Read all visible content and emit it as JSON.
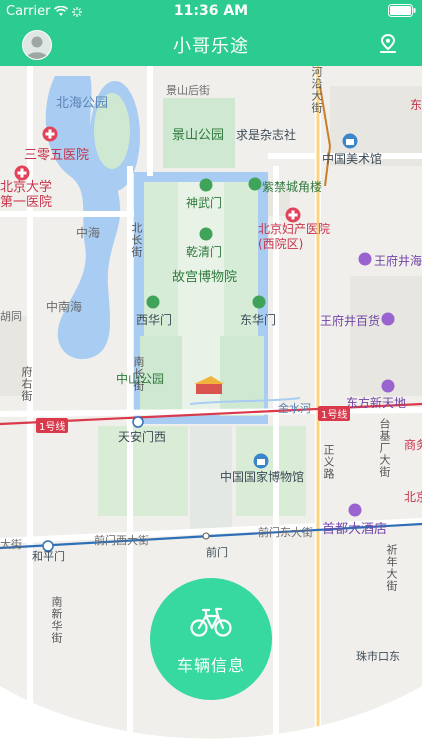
{
  "status_bar": {
    "carrier": "Carrier",
    "time": "11:36 AM"
  },
  "nav": {
    "title": "小哥乐途"
  },
  "map": {
    "labels": {
      "beihai_park": "北海公园",
      "jingshan_houjie": "景山后街",
      "jingshan_park": "景山公园",
      "qiushi_zazhishe": "求是杂志社",
      "china_art_museum": "中国美术馆",
      "hospital_305": "三零五医院",
      "pku_first_hospital": "北京大学\n第一医院",
      "jiaolou": "紫禁城角楼",
      "shenwumen": "神武门",
      "qianqingmen": "乾清门",
      "palace_museum": "故宫博物院",
      "maternity_hospital": "北京妇产医院\n(西院区)",
      "wangfujing_shop": "王府井海",
      "zhonghai": "中海",
      "beichangjie": "北长街",
      "nanchangjie": "南长街",
      "zhongnanhai": "中南海",
      "xihuamen": "西华门",
      "donghuamen": "东华门",
      "wangfujing_baihuo": "王府井百货",
      "hutong": "胡同",
      "zhongshan_park": "中山公园",
      "jinshuihe": "金水河",
      "dongfang_xintiandi": "东方新天地",
      "line1_a": "1号线",
      "line1_b": "1号线",
      "tiananmen_west": "天安门西",
      "taijichang": "台基厂大街",
      "zhengyi_road": "正义路",
      "national_museum": "中国国家博物馆",
      "dongdajie": "大街",
      "heping_men": "和平门",
      "qianmen_xidajie": "前门西大街",
      "qianmen": "前门",
      "qianmen_dongdajie": "前门东大街",
      "capital_hotel": "首都大酒店",
      "qinian_dajie": "祈年大街",
      "nanxinhua": "南新华街",
      "zhushikou": "珠市口东",
      "fuyou": "府右街",
      "hexi": "河沿大街",
      "dongfang_right": "东方",
      "shangwu": "商务",
      "beijing_right": "北京"
    }
  },
  "fab": {
    "label": "车辆信息"
  },
  "colors": {
    "primary": "#2ccb8f",
    "fab": "#37d9a0",
    "water": "#a9cdf2",
    "park": "#cfe8d1",
    "rail": "#d9394a",
    "metro2": "#2f6fb8"
  }
}
